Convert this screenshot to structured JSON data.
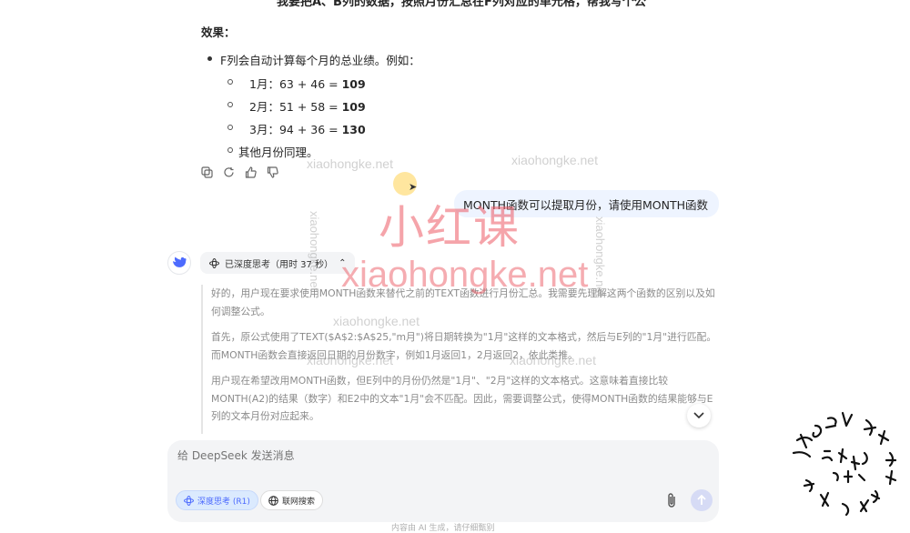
{
  "header": {
    "prompt_line": "我要把A、B列的数据，按照月份汇总在F列对应的单元格，帮我写个公"
  },
  "answer": {
    "effect_label": "效果：",
    "bullet": "F列会自动计算每个月的总业绩。例如：",
    "examples": [
      {
        "prefix": "1月：63 + 46 = ",
        "result": "109"
      },
      {
        "prefix": "2月：51 + 58 = ",
        "result": "109"
      },
      {
        "prefix": "3月：94 + 36 = ",
        "result": "130"
      }
    ],
    "other": "其他月份同理。",
    "action_icons": [
      "copy-icon",
      "regenerate-icon",
      "thumbs-up-icon",
      "thumbs-down-icon"
    ]
  },
  "user_message": "MONTH函数可以提取月份，请使用MONTH函数",
  "thinking": {
    "pill_label": "已深度思考（用时 37 秒）",
    "paragraphs": [
      "好的，用户现在要求使用MONTH函数来替代之前的TEXT函数进行月份汇总。我需要先理解这两个函数的区别以及如何调整公式。",
      "首先，原公式使用了TEXT($A$2:$A$25,\"m月\")将日期转换为\"1月\"这样的文本格式，然后与E列的\"1月\"进行匹配。而MONTH函数会直接返回日期的月份数字，例如1月返回1，2月返回2，依此类推。",
      "用户现在希望改用MONTH函数，但E列中的月份仍然是\"1月\"、\"2月\"这样的文本格式。这意味着直接比较MONTH(A2)的结果（数字）和E2中的文本\"1月\"会不匹配。因此，需要调整公式，使得MONTH函数的结果能够与E列的文本月份对应起来。"
    ]
  },
  "composer": {
    "placeholder": "给 DeepSeek 发送消息",
    "deep_think_label": "深度思考 (R1)",
    "web_search_label": "联网搜索"
  },
  "footer": "内容由 AI 生成，请仔细甄别",
  "watermarks": {
    "small": "xiaohongke.net",
    "big_cn": "小红课",
    "big": "xiaohongke.net"
  },
  "colors": {
    "accent": "#4d6bfe",
    "user_bubble": "#eef4ff",
    "watermark_red": "#ec5a64"
  }
}
